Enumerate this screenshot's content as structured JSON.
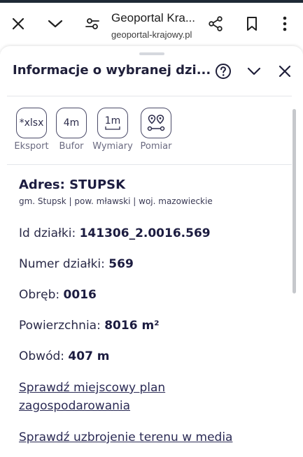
{
  "browser": {
    "title": "Geoportal Kra...",
    "url": "geoportal-krajowy.pl"
  },
  "sheet": {
    "title": "Informacje o wybranej dzi...",
    "tools": [
      {
        "icon_text": "*xlsx",
        "label": "Eksport"
      },
      {
        "icon_text": "4m",
        "label": "Bufor"
      },
      {
        "icon_text": "1m",
        "label": "Wymiary"
      },
      {
        "icon_text": "",
        "label": "Pomiar"
      }
    ],
    "address": {
      "title": "Adres: STUPSK",
      "sub": "gm. Stupsk | pow. mławski | woj. mazowieckie"
    },
    "fields": [
      {
        "label": "Id działki: ",
        "value": "141306_2.0016.569"
      },
      {
        "label": "Numer działki: ",
        "value": "569"
      },
      {
        "label": "Obręb: ",
        "value": "0016"
      },
      {
        "label": "Powierzchnia: ",
        "value": "8016 m²"
      },
      {
        "label": "Obwód: ",
        "value": "407 m"
      }
    ],
    "links": {
      "plan_line1": "Sprawdź miejscowy plan",
      "plan_line2": "zagospodarowania",
      "media": "Sprawdź uzbrojenie terenu w media"
    }
  },
  "icons": {
    "close": "close-icon",
    "dropdown": "chevron-down-icon",
    "settings": "tune-icon",
    "share": "share-icon",
    "bookmark": "bookmark-icon",
    "menu": "more-vert-icon",
    "help": "help-circle-icon"
  }
}
